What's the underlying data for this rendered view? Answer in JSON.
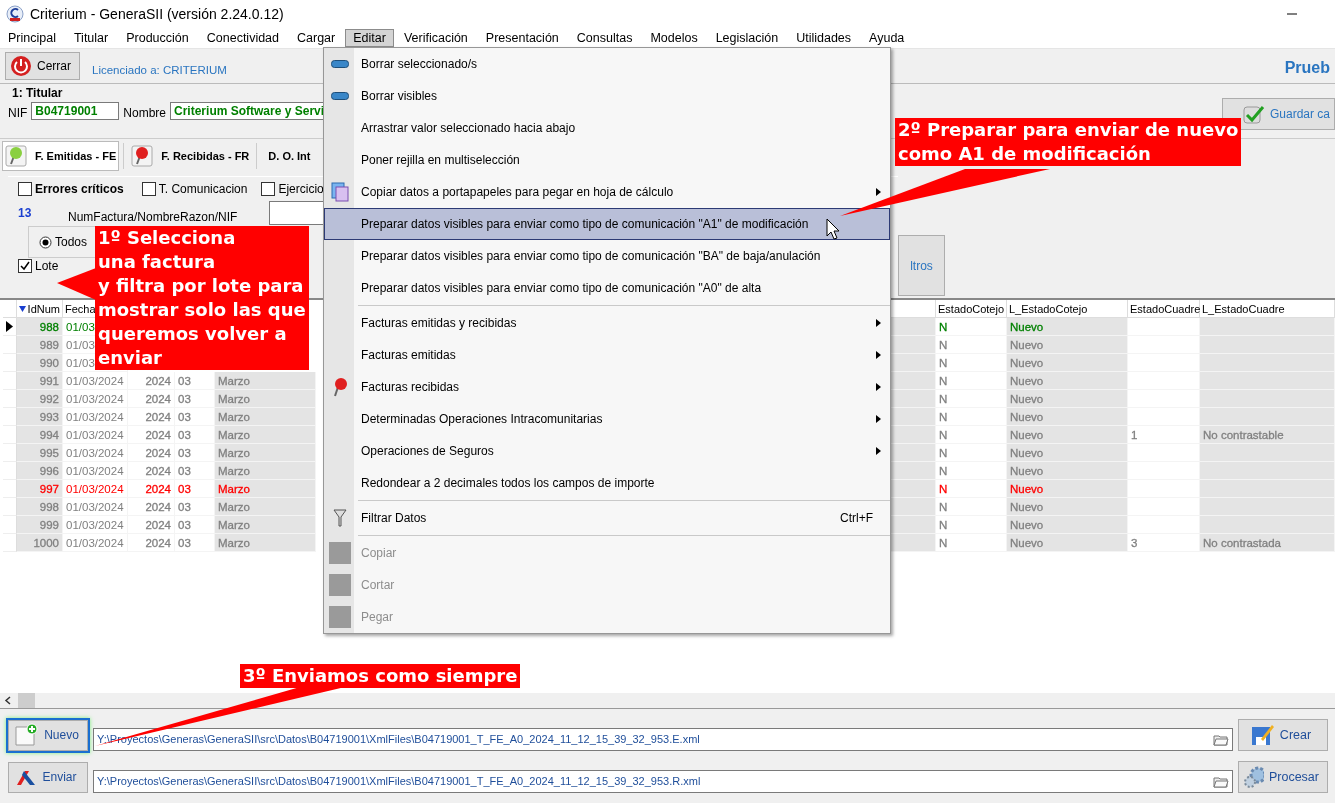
{
  "window": {
    "title": "Criterium - GeneraSII (versión 2.24.0.12)"
  },
  "menu_bar": [
    {
      "label": "Principal",
      "selected": false
    },
    {
      "label": "Titular",
      "selected": false
    },
    {
      "label": "Producción",
      "selected": false
    },
    {
      "label": "Conectividad",
      "selected": false
    },
    {
      "label": "Cargar",
      "selected": false
    },
    {
      "label": "Editar",
      "selected": true
    },
    {
      "label": "Verificación",
      "selected": false
    },
    {
      "label": "Presentación",
      "selected": false
    },
    {
      "label": "Consultas",
      "selected": false
    },
    {
      "label": "Modelos",
      "selected": false
    },
    {
      "label": "Legislación",
      "selected": false
    },
    {
      "label": "Utilidades",
      "selected": false
    },
    {
      "label": "Ayuda",
      "selected": false
    }
  ],
  "toolbar": {
    "close_button": "Cerrar",
    "license": "Licenciado a: CRITERIUM",
    "environment": "Prueb"
  },
  "titular": {
    "title": "1: Titular",
    "nif_label": "NIF",
    "nif": "B04719001",
    "name_label": "Nombre",
    "name": "Criterium Software y Servi",
    "save_button": "Guardar ca"
  },
  "tabs": [
    {
      "label": "F. Emitidas - FE",
      "selected": true
    },
    {
      "label": "F. Recibidas - FR",
      "selected": false
    },
    {
      "label": "D. O. Int",
      "selected": false
    }
  ],
  "filters": {
    "checks": [
      {
        "label": "Errores críticos",
        "checked": false
      },
      {
        "label": "T. Comunicacion",
        "checked": false
      },
      {
        "label": "Ejercicio",
        "checked": false
      }
    ],
    "count": "13",
    "search_label": "NumFactura/NombreRazon/NIF",
    "radio": {
      "label": "Todos",
      "selected": true
    },
    "lote": {
      "label": "Lote",
      "checked": true
    },
    "filter_button": "ltros"
  },
  "grid": {
    "columns": [
      {
        "header": "IdNum",
        "sorted": true
      },
      {
        "header": "Fecha",
        "sorted": false
      },
      {},
      {},
      {},
      {},
      {
        "sorted": false
      },
      {
        "header": "EstadoCotejo",
        "sorted": false
      },
      {
        "header": "L_EstadoCotejo",
        "sorted": false
      },
      {
        "header": "EstadoCuadre",
        "sorted": false
      },
      {
        "header": "L_EstadoCuadre",
        "sorted": false
      }
    ],
    "rows": [
      {
        "current": true,
        "color": "#008000",
        "cells": [
          "988",
          "01/03",
          null,
          null,
          null,
          null,
          null,
          "N",
          "Nuevo",
          null,
          null
        ]
      },
      {
        "current": false,
        "color": "#808080",
        "cells": [
          "989",
          "01/03",
          null,
          null,
          null,
          null,
          null,
          "N",
          "Nuevo",
          null,
          null
        ]
      },
      {
        "current": false,
        "color": "#808080",
        "cells": [
          "990",
          "01/03",
          null,
          null,
          null,
          null,
          null,
          "N",
          "Nuevo",
          null,
          null
        ]
      },
      {
        "current": false,
        "color": "#808080",
        "cells": [
          "991",
          "01/03/2024",
          "2024",
          "03",
          "Marzo",
          null,
          null,
          "N",
          "Nuevo",
          null,
          null
        ]
      },
      {
        "current": false,
        "color": "#808080",
        "cells": [
          "992",
          "01/03/2024",
          "2024",
          "03",
          "Marzo",
          null,
          null,
          "N",
          "Nuevo",
          null,
          null
        ]
      },
      {
        "current": false,
        "color": "#808080",
        "cells": [
          "993",
          "01/03/2024",
          "2024",
          "03",
          "Marzo",
          null,
          null,
          "N",
          "Nuevo",
          null,
          null
        ]
      },
      {
        "current": false,
        "color": "#808080",
        "cells": [
          "994",
          "01/03/2024",
          "2024",
          "03",
          "Marzo",
          null,
          null,
          "N",
          "Nuevo",
          "1",
          "No contrastable"
        ]
      },
      {
        "current": false,
        "color": "#808080",
        "cells": [
          "995",
          "01/03/2024",
          "2024",
          "03",
          "Marzo",
          null,
          null,
          "N",
          "Nuevo",
          null,
          null
        ]
      },
      {
        "current": false,
        "color": "#808080",
        "cells": [
          "996",
          "01/03/2024",
          "2024",
          "03",
          "Marzo",
          null,
          null,
          "N",
          "Nuevo",
          null,
          null
        ]
      },
      {
        "current": false,
        "color": "#ff0000",
        "cells": [
          "997",
          "01/03/2024",
          "2024",
          "03",
          "Marzo",
          null,
          null,
          "N",
          "Nuevo",
          null,
          null
        ]
      },
      {
        "current": false,
        "color": "#808080",
        "cells": [
          "998",
          "01/03/2024",
          "2024",
          "03",
          "Marzo",
          null,
          null,
          "N",
          "Nuevo",
          null,
          null
        ]
      },
      {
        "current": false,
        "color": "#808080",
        "cells": [
          "999",
          "01/03/2024",
          "2024",
          "03",
          "Marzo",
          null,
          null,
          "N",
          "Nuevo",
          null,
          null
        ]
      },
      {
        "current": false,
        "color": "#808080",
        "cells": [
          "1000",
          "01/03/2024",
          "2024",
          "03",
          "Marzo",
          null,
          null,
          "N",
          "Nuevo",
          "3",
          "No contrastada"
        ]
      }
    ]
  },
  "edit_menu": {
    "items": [
      {
        "kind": "item",
        "label": "Borrar seleccionado/s",
        "submenu": false,
        "selected": false,
        "disabled": false
      },
      {
        "kind": "item",
        "label": "Borrar visibles",
        "submenu": false,
        "selected": false,
        "disabled": false
      },
      {
        "kind": "item",
        "label": "Arrastrar valor seleccionado hacia abajo",
        "submenu": false,
        "selected": false,
        "disabled": false
      },
      {
        "kind": "item",
        "label": "Poner rejilla en multiselección",
        "submenu": false,
        "selected": false,
        "disabled": false
      },
      {
        "kind": "item",
        "label": "Copiar datos a portapapeles para pegar en hoja de cálculo",
        "submenu": true,
        "selected": false,
        "disabled": false
      },
      {
        "kind": "item",
        "label": "Preparar datos visibles para enviar como tipo de comunicación \"A1\" de modificación",
        "submenu": false,
        "selected": true,
        "disabled": false
      },
      {
        "kind": "item",
        "label": "Preparar datos visibles para enviar como tipo de comunicación \"BA\" de baja/anulación",
        "submenu": false,
        "selected": false,
        "disabled": false
      },
      {
        "kind": "item",
        "label": "Preparar datos visibles para enviar como tipo de comunicación \"A0\" de alta",
        "submenu": false,
        "selected": false,
        "disabled": false
      },
      {
        "kind": "separator"
      },
      {
        "kind": "item",
        "label": "Facturas emitidas y recibidas",
        "submenu": true,
        "selected": false,
        "disabled": false
      },
      {
        "kind": "item",
        "label": "Facturas emitidas",
        "submenu": true,
        "selected": false,
        "disabled": false
      },
      {
        "kind": "item",
        "label": "Facturas recibidas",
        "submenu": true,
        "selected": false,
        "disabled": false
      },
      {
        "kind": "item",
        "label": "Determinadas Operaciones Intracomunitarias",
        "submenu": true,
        "selected": false,
        "disabled": false
      },
      {
        "kind": "item",
        "label": "Operaciones de Seguros",
        "submenu": true,
        "selected": false,
        "disabled": false
      },
      {
        "kind": "item",
        "label": "Redondear a 2 decimales todos los campos de importe",
        "submenu": false,
        "selected": false,
        "disabled": false
      },
      {
        "kind": "separator"
      },
      {
        "kind": "item",
        "label": "Filtrar Datos",
        "shortcut": "Ctrl+F",
        "submenu": false,
        "selected": false,
        "disabled": false
      },
      {
        "kind": "separator"
      },
      {
        "kind": "item",
        "label": "Copiar",
        "submenu": false,
        "selected": false,
        "disabled": true
      },
      {
        "kind": "item",
        "label": "Cortar",
        "submenu": false,
        "selected": false,
        "disabled": true
      },
      {
        "kind": "item",
        "label": "Pegar",
        "submenu": false,
        "selected": false,
        "disabled": true
      }
    ]
  },
  "callouts": [
    {
      "text": "1º Selecciona\nuna factura\ny filtra por lote para\nmostrar solo las que\nqueremos volver a\nenviar"
    },
    {
      "text": "2º Preparar para enviar de nuevo\ncomo A1 de modificación"
    },
    {
      "text": "3º Enviamos como siempre"
    }
  ],
  "bottom": {
    "rows": [
      {
        "button": "Nuevo",
        "focused": true,
        "path": "Y:\\Proyectos\\Generas\\GeneraSII\\src\\Datos\\B04719001\\XmlFiles\\B04719001_T_FE_A0_2024_11_12_15_39_32_953.E.xml",
        "action": "Crear"
      },
      {
        "button": "Enviar",
        "focused": false,
        "path": "Y:\\Proyectos\\Generas\\GeneraSII\\src\\Datos\\B04719001\\XmlFiles\\B04719001_T_FE_A0_2024_11_12_15_39_32_953.R.xml",
        "action": "Procesar"
      }
    ]
  }
}
